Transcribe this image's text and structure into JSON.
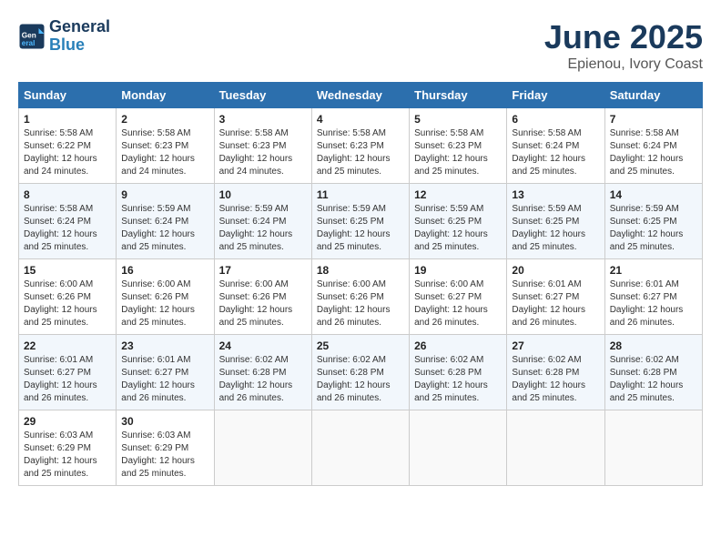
{
  "logo": {
    "line1": "General",
    "line2": "Blue"
  },
  "title": "June 2025",
  "subtitle": "Epienou, Ivory Coast",
  "days_header": [
    "Sunday",
    "Monday",
    "Tuesday",
    "Wednesday",
    "Thursday",
    "Friday",
    "Saturday"
  ],
  "weeks": [
    [
      {
        "day": "1",
        "sunrise": "Sunrise: 5:58 AM",
        "sunset": "Sunset: 6:22 PM",
        "daylight": "Daylight: 12 hours and 24 minutes."
      },
      {
        "day": "2",
        "sunrise": "Sunrise: 5:58 AM",
        "sunset": "Sunset: 6:23 PM",
        "daylight": "Daylight: 12 hours and 24 minutes."
      },
      {
        "day": "3",
        "sunrise": "Sunrise: 5:58 AM",
        "sunset": "Sunset: 6:23 PM",
        "daylight": "Daylight: 12 hours and 24 minutes."
      },
      {
        "day": "4",
        "sunrise": "Sunrise: 5:58 AM",
        "sunset": "Sunset: 6:23 PM",
        "daylight": "Daylight: 12 hours and 25 minutes."
      },
      {
        "day": "5",
        "sunrise": "Sunrise: 5:58 AM",
        "sunset": "Sunset: 6:23 PM",
        "daylight": "Daylight: 12 hours and 25 minutes."
      },
      {
        "day": "6",
        "sunrise": "Sunrise: 5:58 AM",
        "sunset": "Sunset: 6:24 PM",
        "daylight": "Daylight: 12 hours and 25 minutes."
      },
      {
        "day": "7",
        "sunrise": "Sunrise: 5:58 AM",
        "sunset": "Sunset: 6:24 PM",
        "daylight": "Daylight: 12 hours and 25 minutes."
      }
    ],
    [
      {
        "day": "8",
        "sunrise": "Sunrise: 5:58 AM",
        "sunset": "Sunset: 6:24 PM",
        "daylight": "Daylight: 12 hours and 25 minutes."
      },
      {
        "day": "9",
        "sunrise": "Sunrise: 5:59 AM",
        "sunset": "Sunset: 6:24 PM",
        "daylight": "Daylight: 12 hours and 25 minutes."
      },
      {
        "day": "10",
        "sunrise": "Sunrise: 5:59 AM",
        "sunset": "Sunset: 6:24 PM",
        "daylight": "Daylight: 12 hours and 25 minutes."
      },
      {
        "day": "11",
        "sunrise": "Sunrise: 5:59 AM",
        "sunset": "Sunset: 6:25 PM",
        "daylight": "Daylight: 12 hours and 25 minutes."
      },
      {
        "day": "12",
        "sunrise": "Sunrise: 5:59 AM",
        "sunset": "Sunset: 6:25 PM",
        "daylight": "Daylight: 12 hours and 25 minutes."
      },
      {
        "day": "13",
        "sunrise": "Sunrise: 5:59 AM",
        "sunset": "Sunset: 6:25 PM",
        "daylight": "Daylight: 12 hours and 25 minutes."
      },
      {
        "day": "14",
        "sunrise": "Sunrise: 5:59 AM",
        "sunset": "Sunset: 6:25 PM",
        "daylight": "Daylight: 12 hours and 25 minutes."
      }
    ],
    [
      {
        "day": "15",
        "sunrise": "Sunrise: 6:00 AM",
        "sunset": "Sunset: 6:26 PM",
        "daylight": "Daylight: 12 hours and 25 minutes."
      },
      {
        "day": "16",
        "sunrise": "Sunrise: 6:00 AM",
        "sunset": "Sunset: 6:26 PM",
        "daylight": "Daylight: 12 hours and 25 minutes."
      },
      {
        "day": "17",
        "sunrise": "Sunrise: 6:00 AM",
        "sunset": "Sunset: 6:26 PM",
        "daylight": "Daylight: 12 hours and 25 minutes."
      },
      {
        "day": "18",
        "sunrise": "Sunrise: 6:00 AM",
        "sunset": "Sunset: 6:26 PM",
        "daylight": "Daylight: 12 hours and 26 minutes."
      },
      {
        "day": "19",
        "sunrise": "Sunrise: 6:00 AM",
        "sunset": "Sunset: 6:27 PM",
        "daylight": "Daylight: 12 hours and 26 minutes."
      },
      {
        "day": "20",
        "sunrise": "Sunrise: 6:01 AM",
        "sunset": "Sunset: 6:27 PM",
        "daylight": "Daylight: 12 hours and 26 minutes."
      },
      {
        "day": "21",
        "sunrise": "Sunrise: 6:01 AM",
        "sunset": "Sunset: 6:27 PM",
        "daylight": "Daylight: 12 hours and 26 minutes."
      }
    ],
    [
      {
        "day": "22",
        "sunrise": "Sunrise: 6:01 AM",
        "sunset": "Sunset: 6:27 PM",
        "daylight": "Daylight: 12 hours and 26 minutes."
      },
      {
        "day": "23",
        "sunrise": "Sunrise: 6:01 AM",
        "sunset": "Sunset: 6:27 PM",
        "daylight": "Daylight: 12 hours and 26 minutes."
      },
      {
        "day": "24",
        "sunrise": "Sunrise: 6:02 AM",
        "sunset": "Sunset: 6:28 PM",
        "daylight": "Daylight: 12 hours and 26 minutes."
      },
      {
        "day": "25",
        "sunrise": "Sunrise: 6:02 AM",
        "sunset": "Sunset: 6:28 PM",
        "daylight": "Daylight: 12 hours and 26 minutes."
      },
      {
        "day": "26",
        "sunrise": "Sunrise: 6:02 AM",
        "sunset": "Sunset: 6:28 PM",
        "daylight": "Daylight: 12 hours and 25 minutes."
      },
      {
        "day": "27",
        "sunrise": "Sunrise: 6:02 AM",
        "sunset": "Sunset: 6:28 PM",
        "daylight": "Daylight: 12 hours and 25 minutes."
      },
      {
        "day": "28",
        "sunrise": "Sunrise: 6:02 AM",
        "sunset": "Sunset: 6:28 PM",
        "daylight": "Daylight: 12 hours and 25 minutes."
      }
    ],
    [
      {
        "day": "29",
        "sunrise": "Sunrise: 6:03 AM",
        "sunset": "Sunset: 6:29 PM",
        "daylight": "Daylight: 12 hours and 25 minutes."
      },
      {
        "day": "30",
        "sunrise": "Sunrise: 6:03 AM",
        "sunset": "Sunset: 6:29 PM",
        "daylight": "Daylight: 12 hours and 25 minutes."
      },
      null,
      null,
      null,
      null,
      null
    ]
  ]
}
